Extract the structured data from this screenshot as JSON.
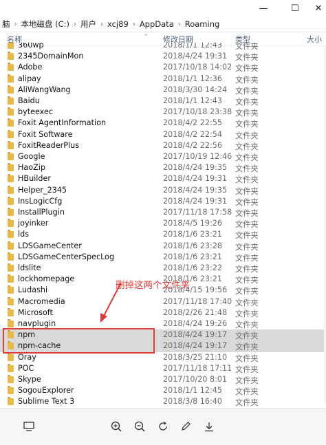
{
  "window": {
    "minimize_glyph": "—",
    "maximize_glyph": "☐",
    "close_glyph": "✕"
  },
  "breadcrumb": [
    "脑",
    "本地磁盘 (C:)",
    "用户",
    "xcj89",
    "AppData",
    "Roaming"
  ],
  "columns": {
    "name": "名称",
    "modified": "修改日期",
    "type": "类型",
    "size": "大小"
  },
  "rows": [
    {
      "name": "360wp",
      "modified": "2018/1/1 12:43",
      "type": "文件夹"
    },
    {
      "name": "2345DomainMon",
      "modified": "2018/4/24 19:31",
      "type": "文件夹"
    },
    {
      "name": "Adobe",
      "modified": "2017/10/18 14:02",
      "type": "文件夹"
    },
    {
      "name": "alipay",
      "modified": "2018/1/1 12:36",
      "type": "文件夹"
    },
    {
      "name": "AliWangWang",
      "modified": "2018/3/30 14:24",
      "type": "文件夹"
    },
    {
      "name": "Baidu",
      "modified": "2018/1/1 12:43",
      "type": "文件夹"
    },
    {
      "name": "byteexec",
      "modified": "2017/10/18 23:38",
      "type": "文件夹"
    },
    {
      "name": "Foxit AgentInformation",
      "modified": "2018/4/2 22:55",
      "type": "文件夹"
    },
    {
      "name": "Foxit Software",
      "modified": "2018/4/2 22:54",
      "type": "文件夹"
    },
    {
      "name": "FoxitReaderPlus",
      "modified": "2018/4/2 22:56",
      "type": "文件夹"
    },
    {
      "name": "Google",
      "modified": "2017/10/19 12:46",
      "type": "文件夹"
    },
    {
      "name": "HaoZip",
      "modified": "2018/4/24 19:35",
      "type": "文件夹"
    },
    {
      "name": "HBuilder",
      "modified": "2018/4/24 19:31",
      "type": "文件夹"
    },
    {
      "name": "Helper_2345",
      "modified": "2018/4/24 19:35",
      "type": "文件夹"
    },
    {
      "name": "InsLogicCfg",
      "modified": "2018/4/24 19:31",
      "type": "文件夹"
    },
    {
      "name": "InstallPlugin",
      "modified": "2017/11/18 17:58",
      "type": "文件夹"
    },
    {
      "name": "joyinker",
      "modified": "2018/4/5 19:26",
      "type": "文件夹"
    },
    {
      "name": "lds",
      "modified": "2018/1/6 23:21",
      "type": "文件夹"
    },
    {
      "name": "LDSGameCenter",
      "modified": "2018/1/6 23:28",
      "type": "文件夹"
    },
    {
      "name": "LDSGameCenterSpecLog",
      "modified": "2018/1/6 23:21",
      "type": "文件夹"
    },
    {
      "name": "ldslite",
      "modified": "2018/1/6 23:22",
      "type": "文件夹"
    },
    {
      "name": "lockhomepage",
      "modified": "2018/1/6 23:21",
      "type": "文件夹"
    },
    {
      "name": "Ludashi",
      "modified": "2018/4/15 19:56",
      "type": "文件夹"
    },
    {
      "name": "Macromedia",
      "modified": "2017/11/18 17:40",
      "type": "文件夹"
    },
    {
      "name": "Microsoft",
      "modified": "2018/2/26 21:48",
      "type": "文件夹"
    },
    {
      "name": "navplugin",
      "modified": "2018/4/24 19:26",
      "type": "文件夹"
    },
    {
      "name": "npm",
      "modified": "2018/4/24 19:17",
      "type": "文件夹",
      "selected": true
    },
    {
      "name": "npm-cache",
      "modified": "2018/4/24 19:17",
      "type": "文件夹",
      "selected": true
    },
    {
      "name": "Oray",
      "modified": "2018/3/25 21:10",
      "type": "文件夹"
    },
    {
      "name": "POC",
      "modified": "2017/11/18 17:11",
      "type": "文件夹"
    },
    {
      "name": "Skype",
      "modified": "2017/10/20 8:01",
      "type": "文件夹"
    },
    {
      "name": "SogouExplorer",
      "modified": "2018/1/1 12:45",
      "type": "文件夹"
    },
    {
      "name": "Sublime Text 3",
      "modified": "2018/3/8 16:40",
      "type": "文件夹"
    }
  ],
  "annotation": {
    "text": "删掉这两个文件夹",
    "color": "#e03a3a"
  },
  "toolbar_icons": [
    "monitor-icon",
    "zoom-in-icon",
    "zoom-out-icon",
    "rotate-icon",
    "edit-icon",
    "download-icon"
  ],
  "colors": {
    "selection": "#d9d9d9",
    "folder": "#e8b84a",
    "annotation": "#e03a3a"
  }
}
